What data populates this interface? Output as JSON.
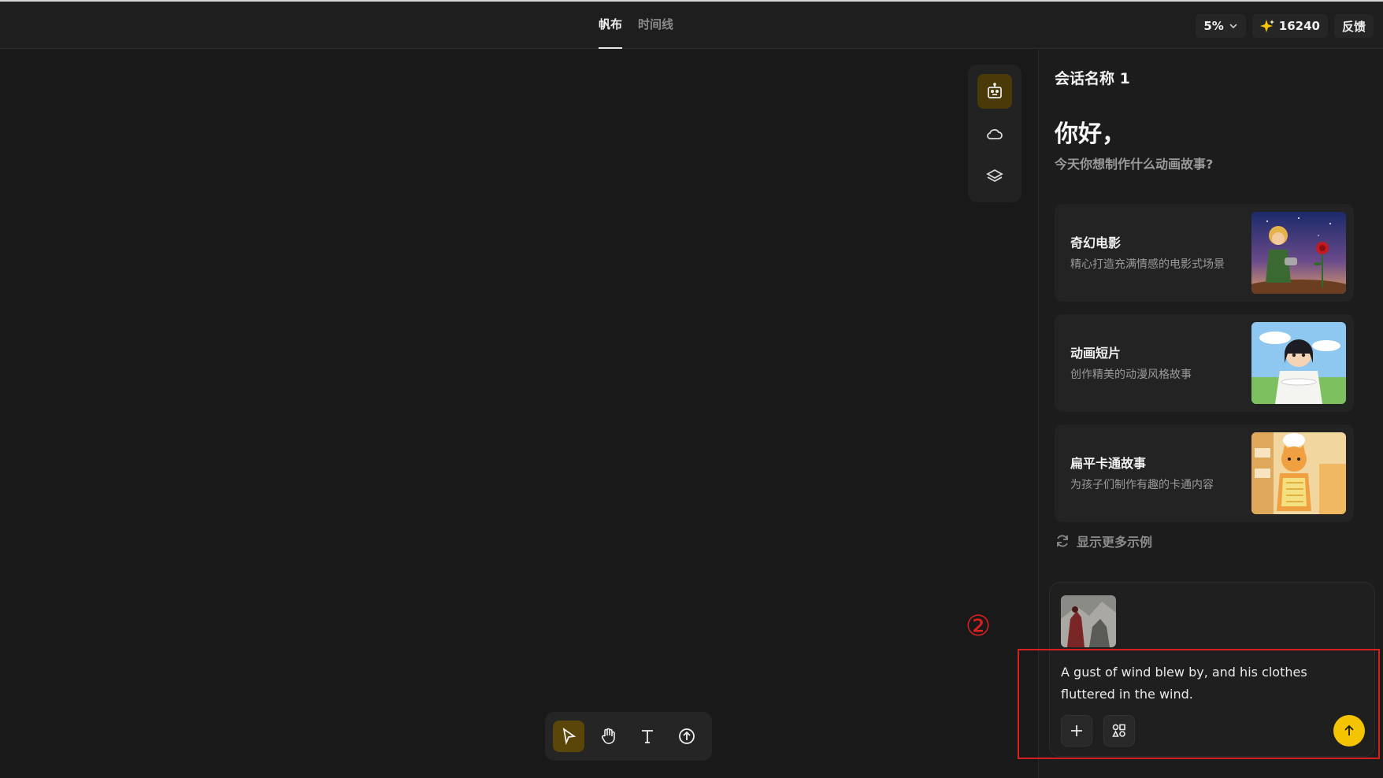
{
  "header": {
    "tabs": [
      {
        "label": "帆布",
        "active": true
      },
      {
        "label": "时间线",
        "active": false
      }
    ],
    "zoom": "5%",
    "credits": "16240",
    "feedback_label": "反馈"
  },
  "tool_rail": {
    "items": [
      {
        "icon": "robot-icon",
        "active": true
      },
      {
        "icon": "cloud-icon",
        "active": false
      },
      {
        "icon": "layers-icon",
        "active": false
      }
    ]
  },
  "bottom_toolbar": {
    "tools": [
      {
        "icon": "pointer-icon",
        "active": true
      },
      {
        "icon": "hand-icon",
        "active": false
      },
      {
        "icon": "text-icon",
        "active": false
      },
      {
        "icon": "upload-icon",
        "active": false
      }
    ]
  },
  "annotation": {
    "number": "②",
    "color": "#e02020"
  },
  "panel": {
    "session_title": "会话名称 1",
    "greeting": "你好，",
    "subtitle": "今天你想制作什么动画故事?",
    "cards": [
      {
        "title": "奇幻电影",
        "desc": "精心打造充满情感的电影式场景"
      },
      {
        "title": "动画短片",
        "desc": "创作精美的动漫风格故事"
      },
      {
        "title": "扁平卡通故事",
        "desc": "为孩子们制作有趣的卡通内容"
      }
    ],
    "more_label": "显示更多示例",
    "composer": {
      "prompt": "A gust of wind blew by, and his clothes fluttered in the wind."
    }
  },
  "colors": {
    "accent": "#f5c400",
    "active_bg": "#4a3a08"
  }
}
